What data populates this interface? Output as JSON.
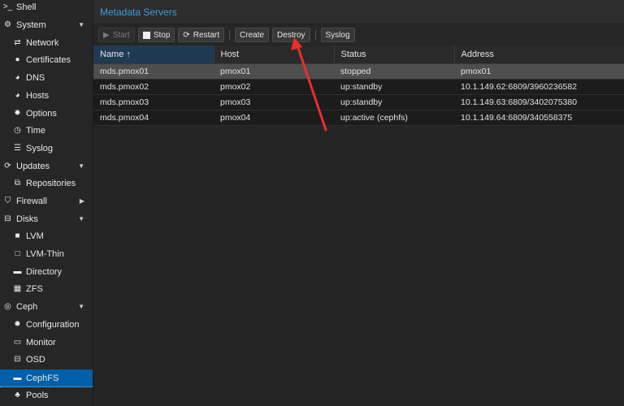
{
  "sidebar": {
    "items": [
      {
        "label": "Shell",
        "icon": "terminal-icon",
        "glyph": ">_",
        "level": 0
      },
      {
        "label": "System",
        "icon": "gears-icon",
        "glyph": "⚙",
        "level": 0,
        "caret": "▼"
      },
      {
        "label": "Network",
        "icon": "exchange-icon",
        "glyph": "⇄",
        "level": 1
      },
      {
        "label": "Certificates",
        "icon": "certificate-icon",
        "glyph": "●",
        "level": 1
      },
      {
        "label": "DNS",
        "icon": "globe-icon",
        "glyph": "◕",
        "level": 1
      },
      {
        "label": "Hosts",
        "icon": "globe-icon",
        "glyph": "◕",
        "level": 1
      },
      {
        "label": "Options",
        "icon": "gear-icon",
        "glyph": "✹",
        "level": 1
      },
      {
        "label": "Time",
        "icon": "clock-icon",
        "glyph": "◷",
        "level": 1
      },
      {
        "label": "Syslog",
        "icon": "list-icon",
        "glyph": "☰",
        "level": 1
      },
      {
        "label": "Updates",
        "icon": "refresh-icon",
        "glyph": "⟳",
        "level": 0,
        "caret": "▼"
      },
      {
        "label": "Repositories",
        "icon": "files-icon",
        "glyph": "⧉",
        "level": 1
      },
      {
        "label": "Firewall",
        "icon": "shield-icon",
        "glyph": "⛉",
        "level": 0,
        "caret": "▶"
      },
      {
        "label": "Disks",
        "icon": "hdd-icon",
        "glyph": "⊟",
        "level": 0,
        "caret": "▼"
      },
      {
        "label": "LVM",
        "icon": "square-icon",
        "glyph": "■",
        "level": 1
      },
      {
        "label": "LVM-Thin",
        "icon": "square-outline-icon",
        "glyph": "□",
        "level": 1
      },
      {
        "label": "Directory",
        "icon": "folder-icon",
        "glyph": "▬",
        "level": 1
      },
      {
        "label": "ZFS",
        "icon": "th-large-icon",
        "glyph": "▦",
        "level": 1
      },
      {
        "label": "Ceph",
        "icon": "ceph-icon",
        "glyph": "◎",
        "level": 0,
        "caret": "▼"
      },
      {
        "label": "Configuration",
        "icon": "gear-icon",
        "glyph": "✹",
        "level": 1
      },
      {
        "label": "Monitor",
        "icon": "desktop-icon",
        "glyph": "▭",
        "level": 1
      },
      {
        "label": "OSD",
        "icon": "hdd-icon",
        "glyph": "⊟",
        "level": 1
      },
      {
        "label": "CephFS",
        "icon": "folder-icon",
        "glyph": "▬",
        "level": 1,
        "selected": true
      },
      {
        "label": "Pools",
        "icon": "sitemap-icon",
        "glyph": "♣",
        "level": 1
      }
    ]
  },
  "panel": {
    "title": "Metadata Servers"
  },
  "toolbar": {
    "start_label": "Start",
    "stop_label": "Stop",
    "restart_label": "Restart",
    "create_label": "Create",
    "destroy_label": "Destroy",
    "syslog_label": "Syslog"
  },
  "table": {
    "columns": [
      "Name ↑",
      "Host",
      "Status",
      "Address"
    ],
    "rows": [
      {
        "name": "mds.pmox01",
        "host": "pmox01",
        "status": "stopped",
        "address": "pmox01",
        "selected": true
      },
      {
        "name": "mds.pmox02",
        "host": "pmox02",
        "status": "up:standby",
        "address": "10.1.149.62:6809/3960236582"
      },
      {
        "name": "mds.pmox03",
        "host": "pmox03",
        "status": "up:standby",
        "address": "10.1.149.63:6809/3402075380"
      },
      {
        "name": "mds.pmox04",
        "host": "pmox04",
        "status": "up:active (cephfs)",
        "address": "10.1.149.64:6809/340558375"
      }
    ]
  },
  "colors": {
    "accent": "#3d9bd9",
    "selected_nav": "#005fa8",
    "annotation_arrow": "#e8302b"
  }
}
